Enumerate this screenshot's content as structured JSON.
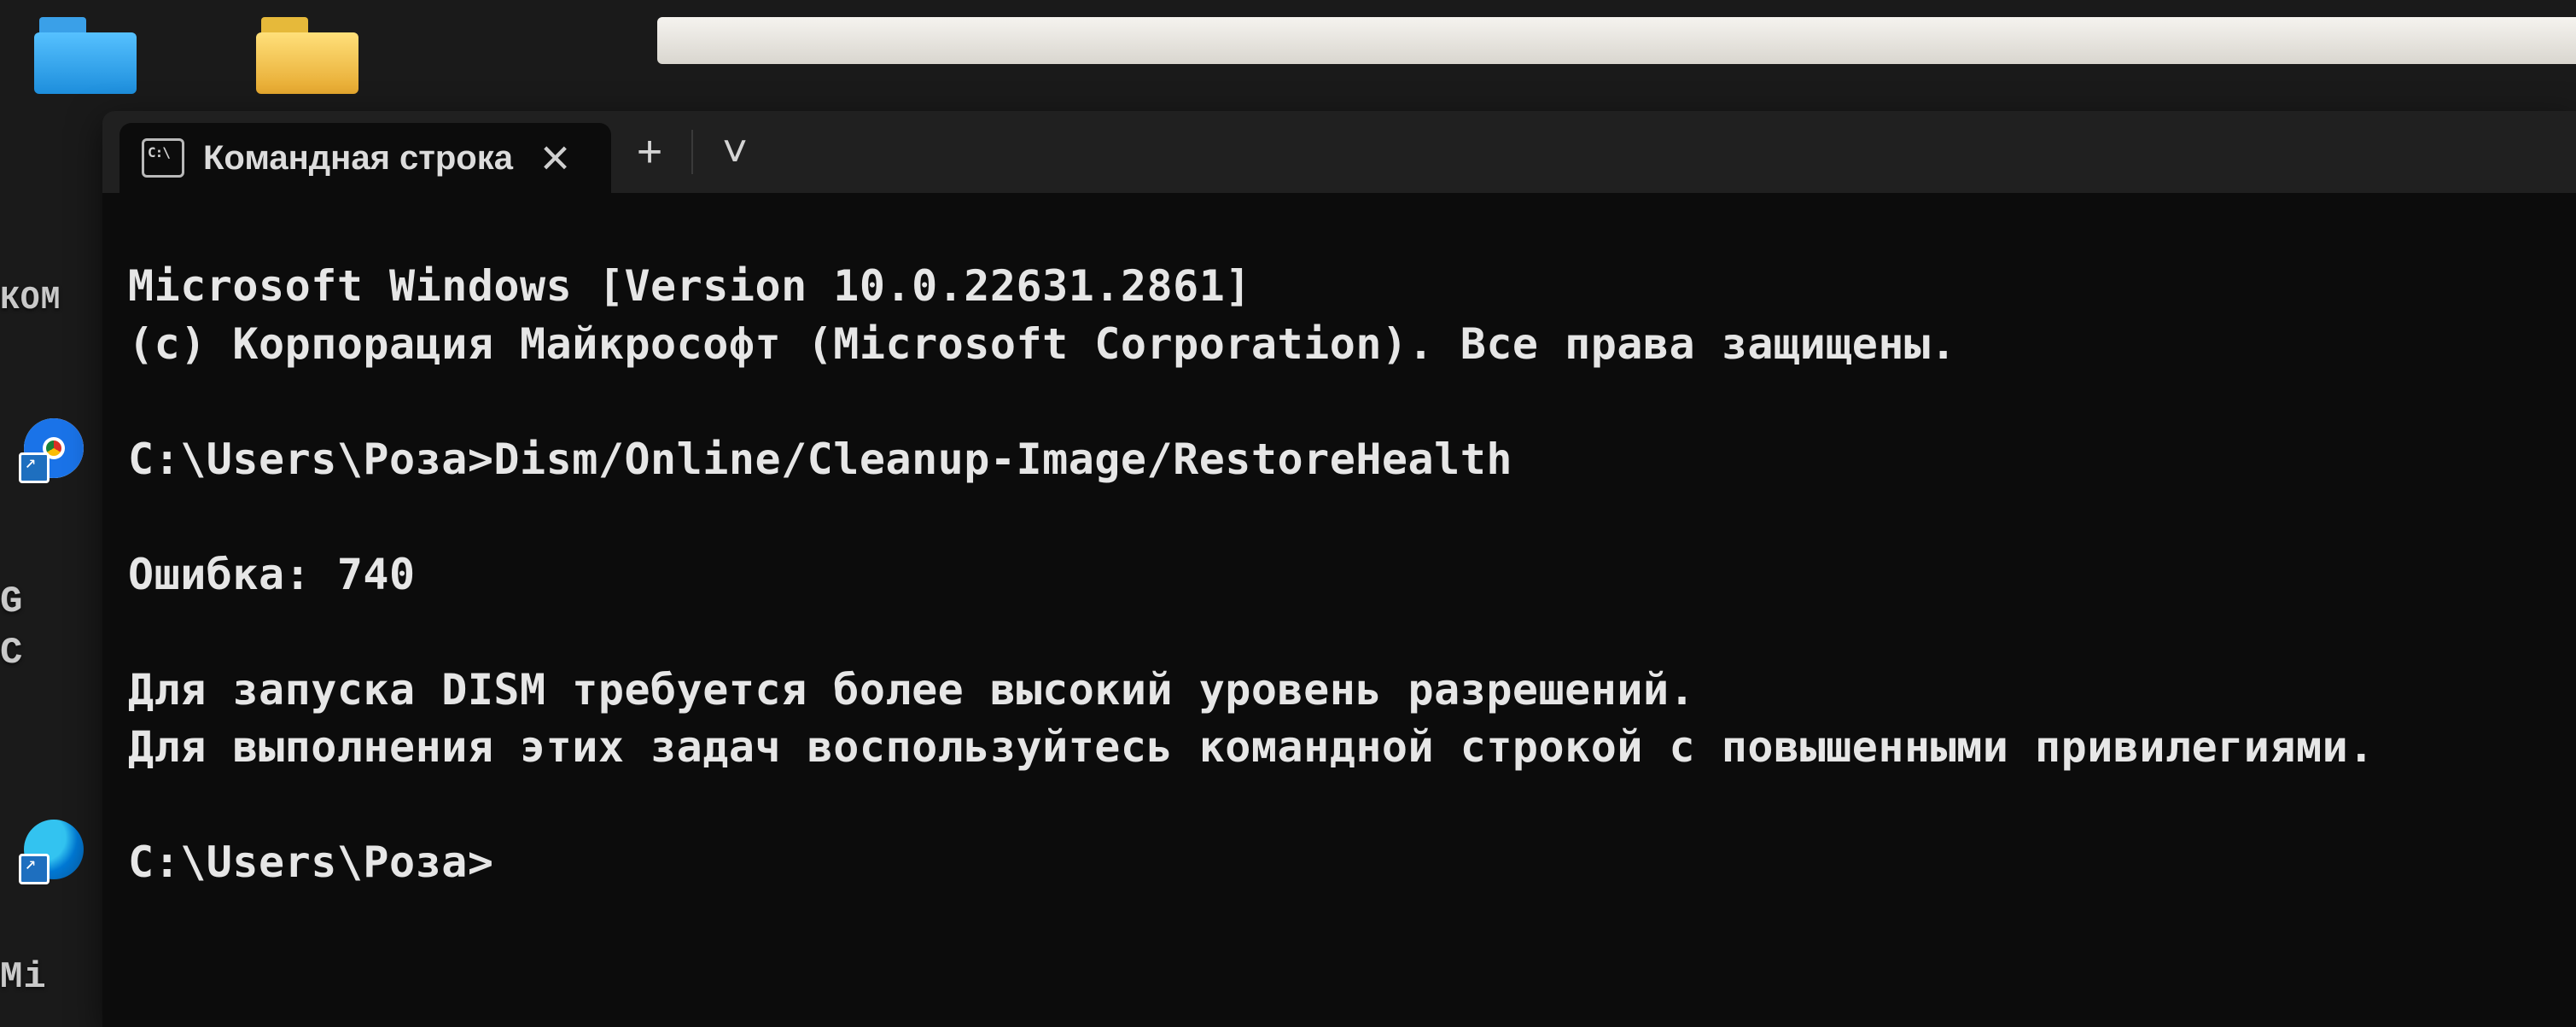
{
  "desktop": {
    "left_text_kom": "КОМ",
    "left_text_g": "G",
    "left_text_c": "C",
    "left_text_m": "Mi"
  },
  "terminal": {
    "tab_title": "Командная строка",
    "lines": {
      "l0": "Microsoft Windows [Version 10.0.22631.2861]",
      "l1": "(c) Корпорация Майкрософт (Microsoft Corporation). Все права защищены.",
      "l2": "",
      "l3": "C:\\Users\\Роза>Dism/Online/Cleanup-Image/RestoreHealth",
      "l4": "",
      "l5": "Ошибка: 740",
      "l6": "",
      "l7": "Для запуска DISM требуется более высокий уровень разрешений.",
      "l8": "Для выполнения этих задач воспользуйтесь командной строкой с повышенными привилегиями.",
      "l9": "",
      "l10": "C:\\Users\\Роза>"
    }
  }
}
